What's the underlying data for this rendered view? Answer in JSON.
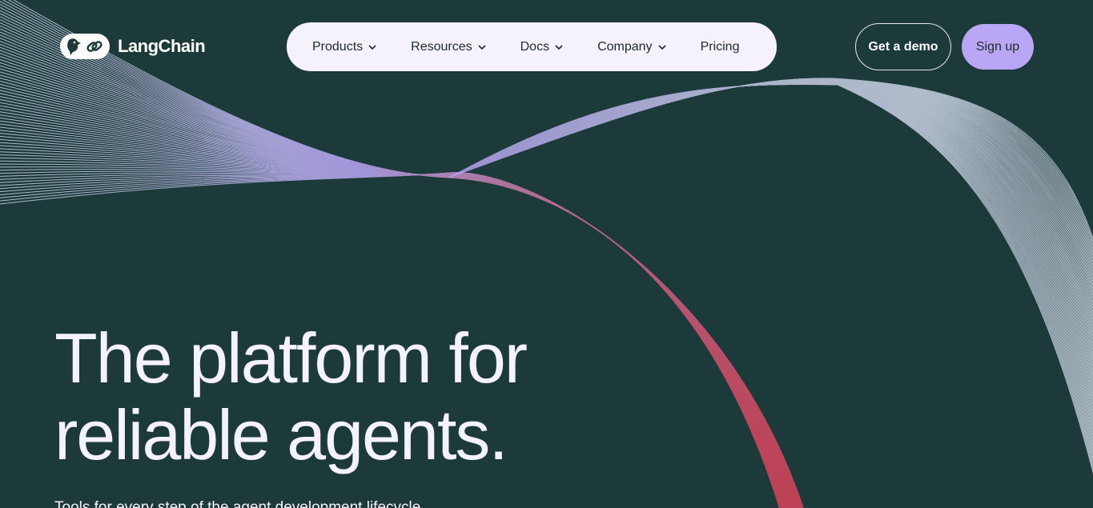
{
  "brand": {
    "name": "LangChain",
    "logo_icons": [
      "parrot-icon",
      "chain-link-icon"
    ]
  },
  "nav": {
    "items": [
      {
        "label": "Products",
        "has_dropdown": true
      },
      {
        "label": "Resources",
        "has_dropdown": true
      },
      {
        "label": "Docs",
        "has_dropdown": true
      },
      {
        "label": "Company",
        "has_dropdown": true
      },
      {
        "label": "Pricing",
        "has_dropdown": false
      }
    ]
  },
  "actions": {
    "demo_label": "Get a demo",
    "signup_label": "Sign up"
  },
  "hero": {
    "title_line1": "The platform for",
    "title_line2": "reliable agents.",
    "subtitle": "Tools for every step of the agent development lifecycle"
  },
  "colors": {
    "background": "#1d3a3a",
    "nav_bg": "#f5f2fb",
    "signup_bg": "#b9a7f5",
    "wave_lavender": "#b9a7f5",
    "wave_red": "#d9435a"
  }
}
